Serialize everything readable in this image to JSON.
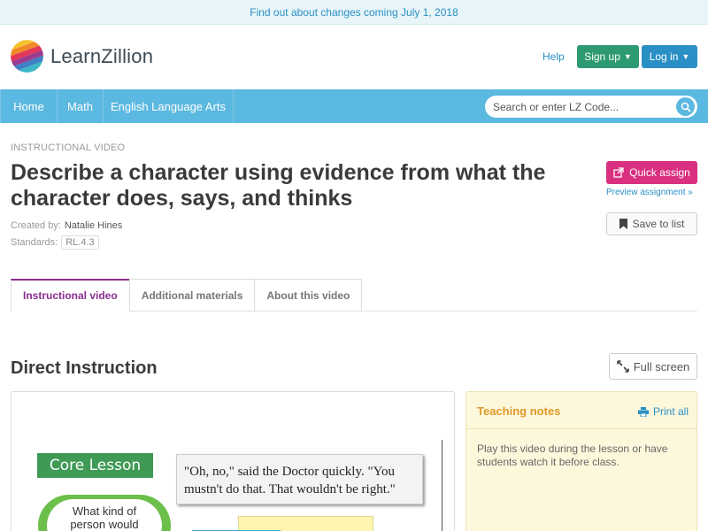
{
  "banner": {
    "text": "Find out about changes coming July 1, 2018"
  },
  "header": {
    "logo_text": "LearnZillion",
    "help_label": "Help",
    "signup_label": "Sign up",
    "login_label": "Log in"
  },
  "nav": {
    "items": [
      {
        "label": "Home"
      },
      {
        "label": "Math"
      },
      {
        "label": "English Language Arts"
      }
    ],
    "search_placeholder": "Search or enter LZ Code..."
  },
  "lesson": {
    "kind": "INSTRUCTIONAL VIDEO",
    "title": "Describe a character using evidence from what the character does, says, and thinks",
    "created_by_label": "Created by:",
    "author": "Natalie Hines",
    "standards_label": "Standards:",
    "standard": "RL.4.3"
  },
  "actions": {
    "quick_assign": "Quick assign",
    "preview": "Preview assignment »",
    "save_to_list": "Save to list"
  },
  "tabs": [
    {
      "label": "Instructional video",
      "active": true
    },
    {
      "label": "Additional materials",
      "active": false
    },
    {
      "label": "About this video",
      "active": false
    }
  ],
  "section": {
    "title": "Direct Instruction",
    "fullscreen_label": "Full screen"
  },
  "video": {
    "badge": "Core Lesson",
    "quote": "\"Oh, no,\" said the Doctor quickly. \"You mustn't do that. That wouldn't be right.\"",
    "cloud_text": "What kind of person would"
  },
  "notes": {
    "title": "Teaching notes",
    "print_label": "Print all",
    "body": "Play this video during the lesson or have students watch it before class."
  },
  "colors": {
    "nav_blue": "#5bb8e0",
    "signup_green": "#2e9a72",
    "login_blue": "#2a8fc4",
    "quick_assign_pink": "#d9307f",
    "active_tab_purple": "#8a2e8f",
    "notes_orange": "#e09a2a"
  }
}
